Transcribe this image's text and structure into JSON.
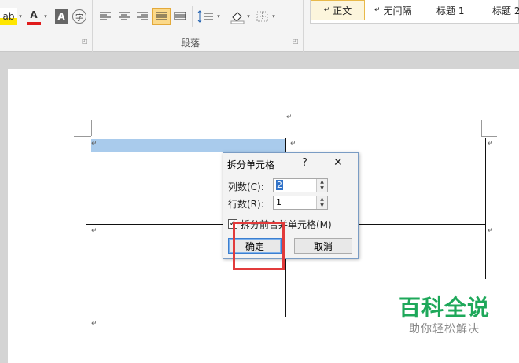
{
  "ribbon": {
    "highlight_btn": "ab",
    "font_color_btn": "A",
    "char_shading_btn": "A",
    "enclose_char_btn": "字",
    "paragraph_group_label": "段落",
    "styles": [
      "正文",
      "无间隔",
      "标题 1",
      "标题 2"
    ],
    "style_symbol": "↵"
  },
  "document": {
    "paragraph_mark": "↵"
  },
  "dialog": {
    "title": "拆分单元格",
    "help": "?",
    "close": "✕",
    "columns_label": "列数(C):",
    "columns_value": "2",
    "rows_label": "行数(R):",
    "rows_value": "1",
    "merge_checkbox_label": "拆分前合并单元格(M)",
    "ok_label": "确定",
    "cancel_label": "取消"
  },
  "watermark": {
    "main": "百科全说",
    "sub": "助你轻松解决"
  },
  "colors": {
    "cell_selection": "#a9cbec",
    "highlight_box": "#e23b3b",
    "watermark_green": "#1ea85a"
  }
}
